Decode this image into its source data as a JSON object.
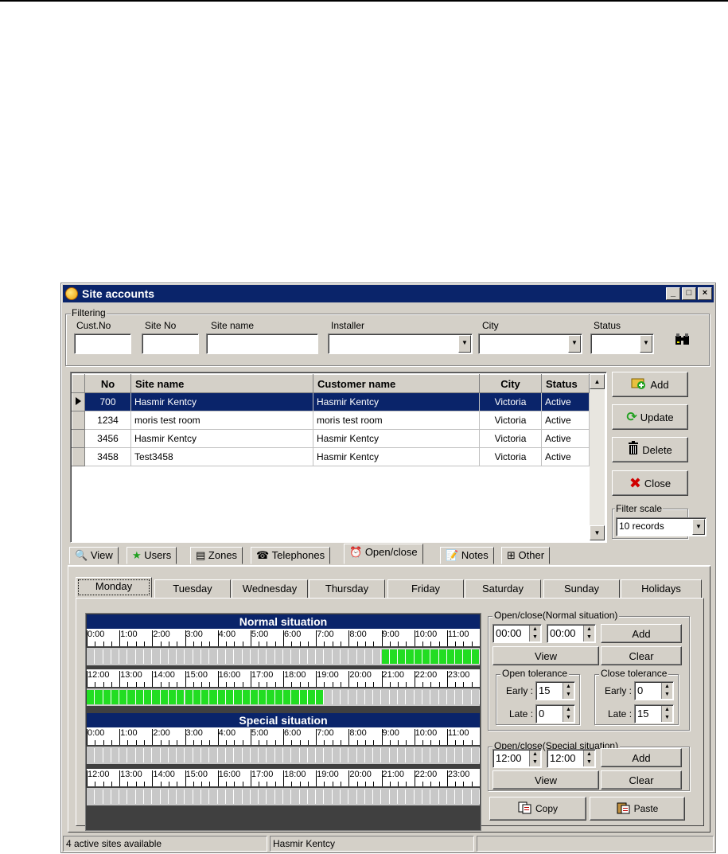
{
  "window": {
    "title": "Site accounts",
    "min": "_",
    "max": "□",
    "close": "×"
  },
  "filter": {
    "group_label": "Filtering",
    "cust_no": "Cust.No",
    "site_no": "Site No",
    "site_name": "Site name",
    "installer": "Installer",
    "city": "City",
    "status": "Status"
  },
  "grid": {
    "columns": [
      "No",
      "Site name",
      "Customer name",
      "City",
      "Status"
    ],
    "rows": [
      {
        "no": "700",
        "site": "Hasmir Kentcy",
        "customer": "Hasmir Kentcy",
        "city": "Victoria",
        "status": "Active"
      },
      {
        "no": "1234",
        "site": "moris test room",
        "customer": "moris test room",
        "city": "Victoria",
        "status": "Active"
      },
      {
        "no": "3456",
        "site": "Hasmir Kentcy",
        "customer": "Hasmir Kentcy",
        "city": "Victoria",
        "status": "Active"
      },
      {
        "no": "3458",
        "site": "Test3458",
        "customer": "Hasmir Kentcy",
        "city": "Victoria",
        "status": "Active"
      }
    ]
  },
  "side": {
    "add": "Add",
    "update": "Update",
    "delete": "Delete",
    "close": "Close",
    "filter_scale": "Filter scale",
    "filter_scale_value": "10 records"
  },
  "tabs": [
    "View",
    "Users",
    "Zones",
    "Telephones",
    "Open/close",
    "Notes",
    "Other"
  ],
  "days": [
    "Monday",
    "Tuesday",
    "Wednesday",
    "Thursday",
    "Friday",
    "Saturday",
    "Sunday",
    "Holidays"
  ],
  "schedule": {
    "normal_title": "Normal situation",
    "special_title": "Special situation",
    "hours_am": [
      "0:00",
      "1:00",
      "2:00",
      "3:00",
      "4:00",
      "5:00",
      "6:00",
      "7:00",
      "8:00",
      "9:00",
      "10:00",
      "11:00"
    ],
    "hours_pm": [
      "12:00",
      "13:00",
      "14:00",
      "15:00",
      "16:00",
      "17:00",
      "18:00",
      "19:00",
      "20:00",
      "21:00",
      "22:00",
      "23:00"
    ],
    "active_color": "#22dd22"
  },
  "normal_panel": {
    "title": "Open/close(Normal situation)",
    "from": "00:00",
    "to": "00:00",
    "add": "Add",
    "view": "View",
    "clear": "Clear",
    "open_tol": "Open tolerance",
    "close_tol": "Close tolerance",
    "early": "Early :",
    "late": "Late :",
    "open_early": "15",
    "open_late": "0",
    "close_early": "0",
    "close_late": "15"
  },
  "special_panel": {
    "title": "Open/close(Special situation)",
    "from": "12:00",
    "to": "12:00",
    "add": "Add",
    "view": "View",
    "clear": "Clear",
    "copy": "Copy",
    "paste": "Paste"
  },
  "statusbar": {
    "left": "4 active sites available",
    "mid": "Hasmir Kentcy",
    "right": ""
  }
}
